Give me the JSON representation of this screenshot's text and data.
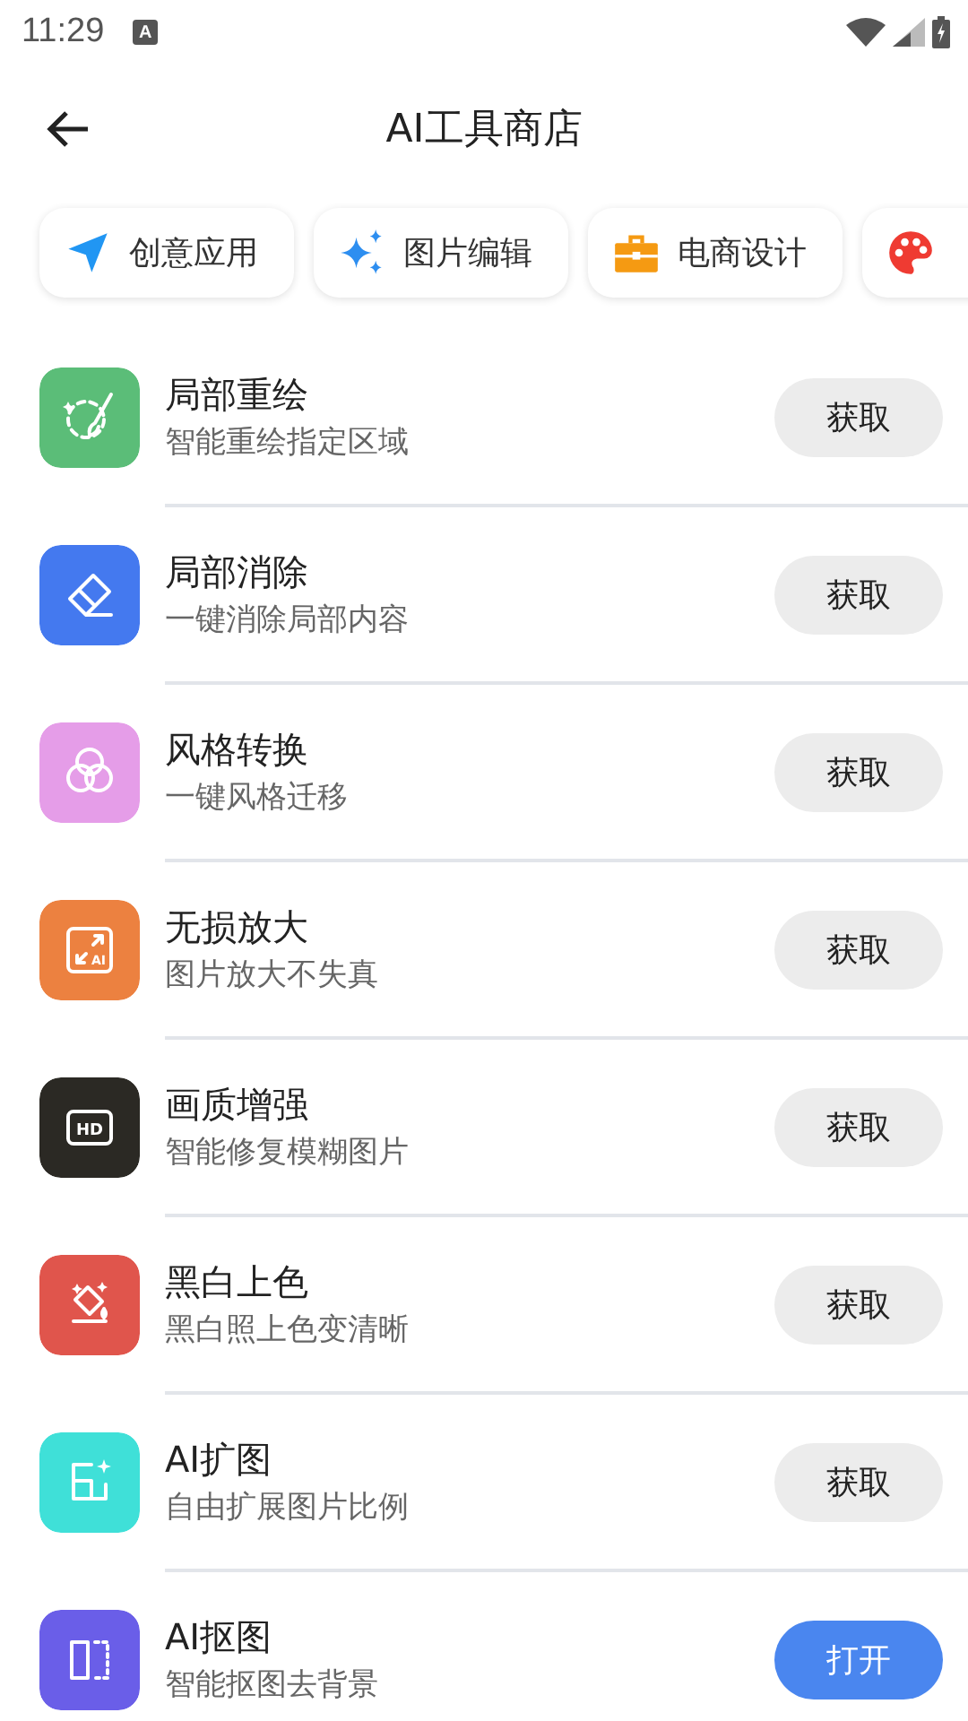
{
  "status_bar": {
    "time": "11:29",
    "notification_letter": "A"
  },
  "header": {
    "title": "AI工具商店"
  },
  "categories": [
    {
      "kind": "navigation",
      "label": "创意应用"
    },
    {
      "kind": "sparkles",
      "label": "图片编辑"
    },
    {
      "kind": "briefcase",
      "label": "电商设计"
    },
    {
      "kind": "palette"
    }
  ],
  "tools": [
    {
      "color": "#5bbd78",
      "title": "局部重绘",
      "subtitle": "智能重绘指定区域",
      "action": "获取",
      "installed": false
    },
    {
      "color": "#4479ef",
      "title": "局部消除",
      "subtitle": "一键消除局部内容",
      "action": "获取",
      "installed": false
    },
    {
      "color": "#e59de8",
      "title": "风格转换",
      "subtitle": "一键风格迁移",
      "action": "获取",
      "installed": false
    },
    {
      "icon_text": "AI",
      "color": "#ec8140",
      "title": "无损放大",
      "subtitle": "图片放大不失真",
      "action": "获取",
      "installed": false
    },
    {
      "icon_text": "HD",
      "color": "#2b2924",
      "title": "画质增强",
      "subtitle": "智能修复模糊图片",
      "action": "获取",
      "installed": false
    },
    {
      "color": "#e0554c",
      "title": "黑白上色",
      "subtitle": "黑白照上色变清晰",
      "action": "获取",
      "installed": false
    },
    {
      "color": "#3fe0d8",
      "title": "AI扩图",
      "subtitle": "自由扩展图片比例",
      "action": "获取",
      "installed": false
    },
    {
      "color": "#6a5ee8",
      "title": "AI抠图",
      "subtitle": "智能抠图去背景",
      "action": "打开",
      "installed": true
    }
  ]
}
